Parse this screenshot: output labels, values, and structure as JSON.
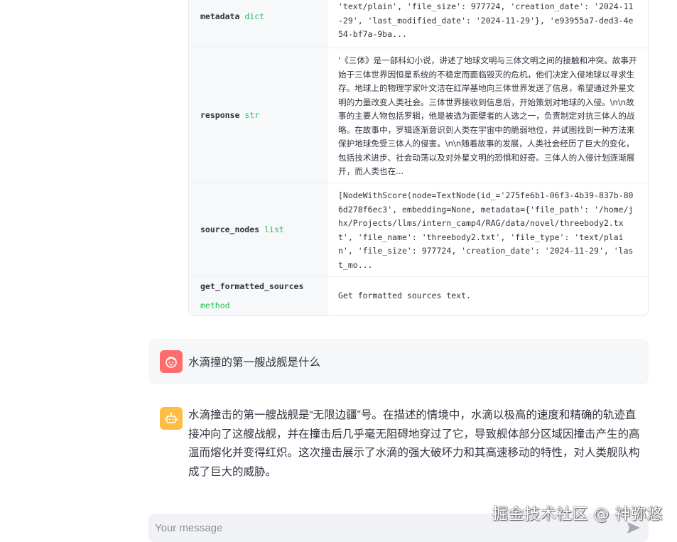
{
  "attributes": [
    {
      "name": "metadata",
      "type": "dict",
      "value": "'text/plain', 'file_size': 977724, 'creation_date': '2024-11-29', 'last_modified_date': '2024-11-29'}, 'e93955a7-ded3-4e54-bf7a-9ba..."
    },
    {
      "name": "response",
      "type": "str",
      "value": "'《三体》是一部科幻小说，讲述了地球文明与三体文明之间的接触和冲突。故事开始于三体世界因恒星系统的不稳定而面临毁灭的危机，他们决定入侵地球以寻求生存。地球上的物理学家叶文洁在红岸基地向三体世界发送了信息，希望通过外星文明的力量改变人类社会。三体世界接收到信息后，开始策划对地球的入侵。\\n\\n故事的主要人物包括罗辑，他是被选为面壁者的人选之一，负责制定对抗三体人的战略。在故事中，罗辑逐渐意识到人类在宇宙中的脆弱地位，并试图找到一种方法来保护地球免受三体人的侵害。\\n\\n随着故事的发展，人类社会经历了巨大的变化，包括技术进步、社会动荡以及对外星文明的恐惧和好奇。三体人的入侵计划逐渐展开，而人类也在..."
    },
    {
      "name": "source_nodes",
      "type": "list",
      "value": "[NodeWithScore(node=TextNode(id_='275fe6b1-06f3-4b39-837b-806d278f6ec3', embedding=None, metadata={'file_path': '/home/jhx/Projects/llms/intern_camp4/RAG/data/novel/threebody2.txt', 'file_name': 'threebody2.txt', 'file_type': 'text/plain', 'file_size': 977724, 'creation_date': '2024-11-29', 'last_mo..."
    },
    {
      "name": "get_formatted_sources",
      "type": "method",
      "value": "Get formatted sources text."
    }
  ],
  "chat": {
    "user_message": "水滴撞的第一艘战舰是什么",
    "assistant_message": "水滴撞击的第一艘战舰是“无限边疆”号。在描述的情境中，水滴以极高的速度和精确的轨迹直接冲向了这艘战舰，并在撞击后几乎毫无阻碍地穿过了它，导致舰体部分区域因撞击产生的高温而熔化并变得红炽。这次撞击展示了水滴的强大破坏力和其高速移动的特性，对人类舰队构成了巨大的威胁。",
    "input_placeholder": "Your message"
  },
  "watermark": "掘金技术社区 @ 神弥悠",
  "icons": {
    "user_avatar": "user-face-icon",
    "assistant_avatar": "robot-icon",
    "send": "send-arrow-icon"
  },
  "colors": {
    "user_avatar": "#ff6c6c",
    "assistant_avatar": "#ffbd45",
    "type_label": "#21c354"
  }
}
